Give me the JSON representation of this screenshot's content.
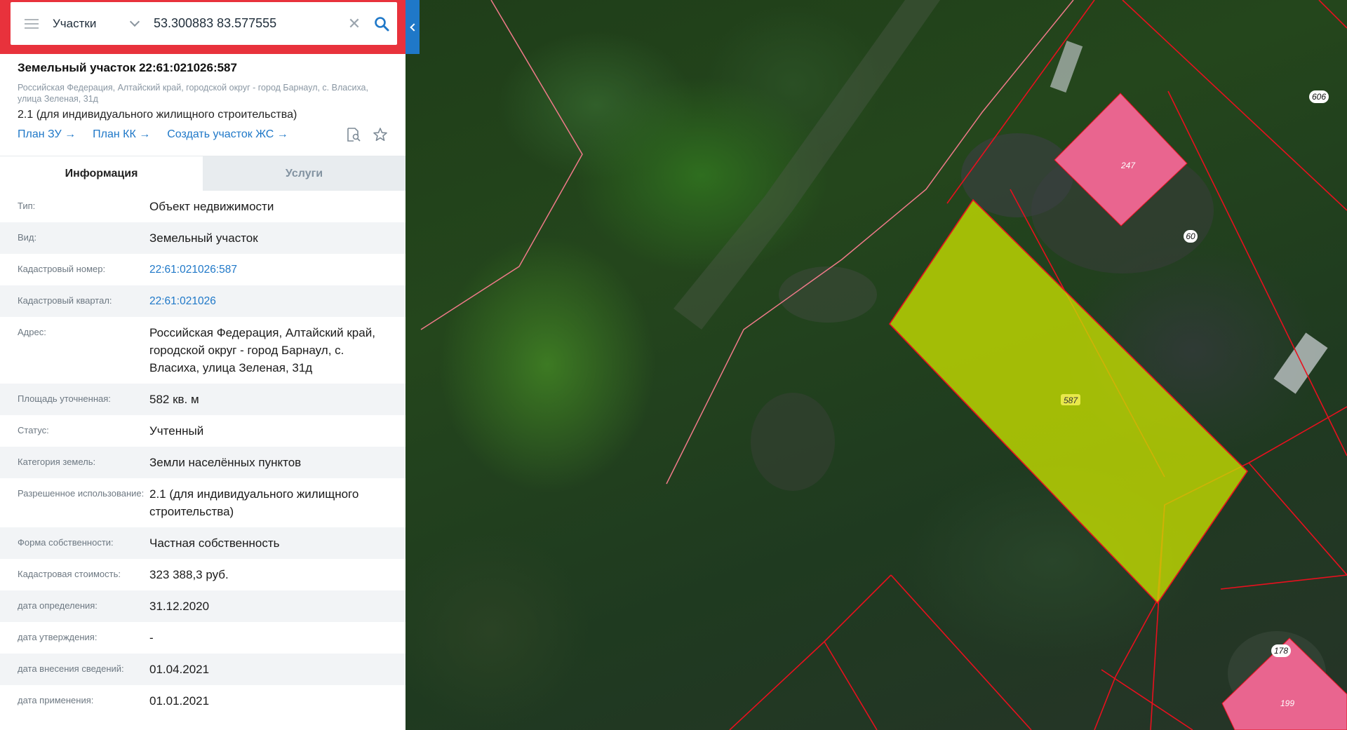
{
  "search": {
    "layer": "Участки",
    "query": "53.300883 83.577555",
    "clear_icon": "close-icon",
    "search_icon": "search-icon"
  },
  "parcel": {
    "title": "Земельный участок 22:61:021026:587",
    "address_short": "Российская Федерация, Алтайский край, городской округ - город Барнаул, с. Власиха, улица Зеленая, 31д",
    "purpose": "2.1 (для индивидуального жилищного строительства)",
    "links": [
      "План ЗУ →",
      "План КК →",
      "Создать участок ЖС →"
    ]
  },
  "tabs": [
    "Информация",
    "Услуги"
  ],
  "info_rows": [
    {
      "key": "Тип:",
      "value": "Объект недвижимости"
    },
    {
      "key": "Вид:",
      "value": "Земельный участок"
    },
    {
      "key": "Кадастровый номер:",
      "value": "22:61:021026:587"
    },
    {
      "key": "Кадастровый квартал:",
      "value": "22:61:021026"
    },
    {
      "key": "Адрес:",
      "value": "Российская Федерация, Алтайский край, городской округ - город Барнаул, с. Власиха, улица Зеленая, 31д"
    },
    {
      "key": "Площадь уточненная:",
      "value": "582 кв. м"
    },
    {
      "key": "Статус:",
      "value": "Учтенный"
    },
    {
      "key": "Категория земель:",
      "value": "Земли населённых пунктов"
    },
    {
      "key": "Разрешенное использование:",
      "value": "2.1 (для индивидуального жилищного строительства)"
    },
    {
      "key": "Форма собственности:",
      "value": "Частная собственность"
    },
    {
      "key": "Кадастровая стоимость:",
      "value": "323 388,3 руб."
    },
    {
      "key": "дата определения:",
      "value": "31.12.2020"
    },
    {
      "key": "дата утверждения:",
      "value": "-"
    },
    {
      "key": "дата внесения сведений:",
      "value": "01.04.2021"
    },
    {
      "key": "дата применения:",
      "value": "01.01.2021"
    }
  ],
  "map": {
    "labels": [
      "606",
      "247",
      "60",
      "587",
      "178",
      "199"
    ],
    "colors": {
      "selected_parcel": "#c8e000",
      "parcel_border": "#e8101e",
      "building_fill": "#e9658f",
      "quarter_line": "#f07a8a"
    }
  }
}
